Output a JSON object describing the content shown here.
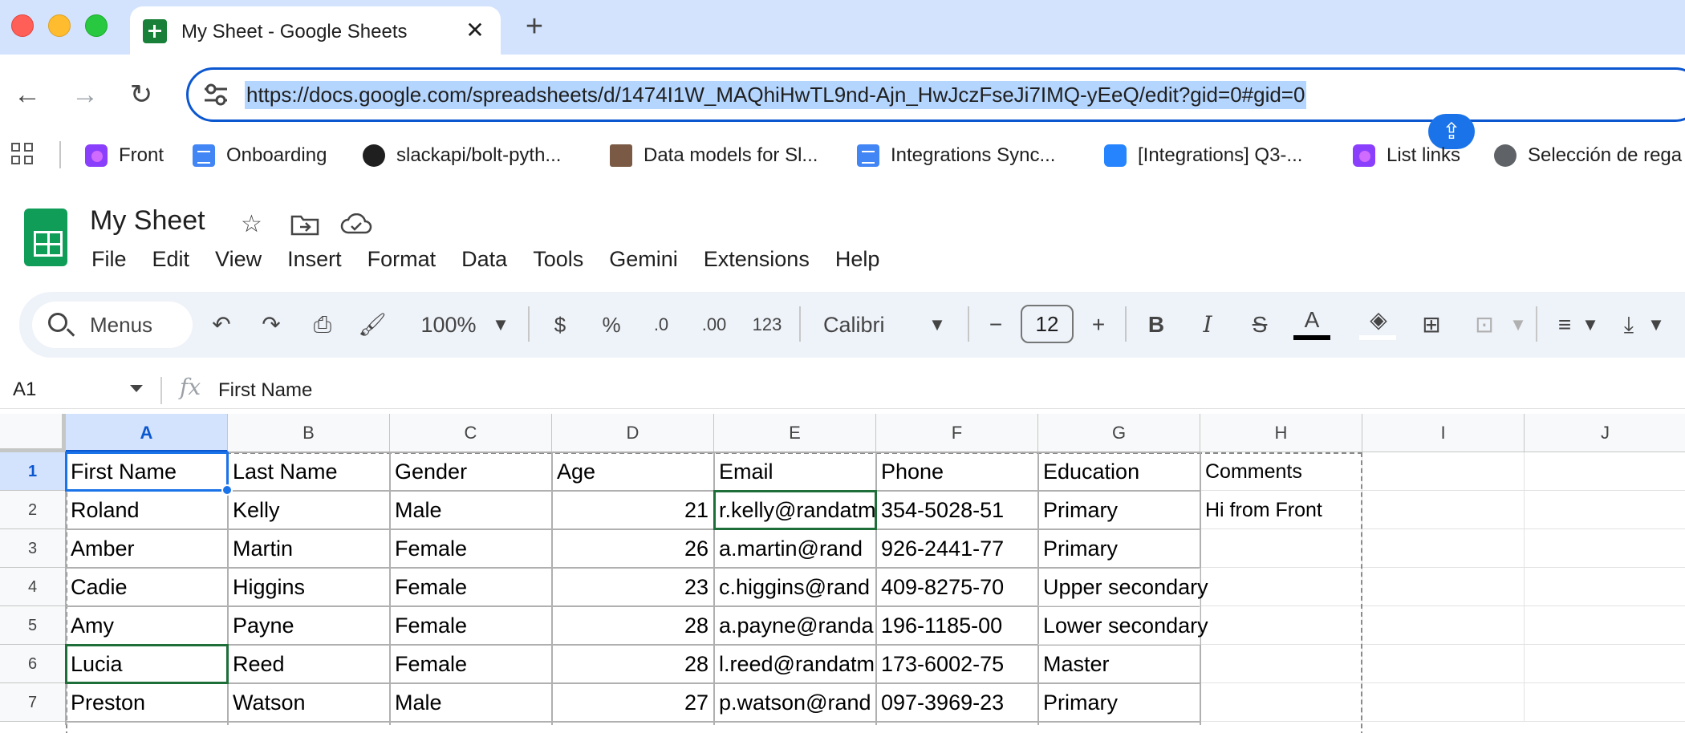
{
  "browser": {
    "tab_title": "My Sheet - Google Sheets",
    "tab_close": "✕",
    "new_tab": "+",
    "url": "https://docs.google.com/spreadsheets/d/1474I1W_MAQhiHwTL9nd-Ajn_HwJczFseJi7IMQ-yEeQ/edit?gid=0#gid=0",
    "bookmarks": [
      {
        "label": "Front",
        "icon": "front"
      },
      {
        "label": "Onboarding",
        "icon": "doc"
      },
      {
        "label": "slackapi/bolt-pyth...",
        "icon": "gh"
      },
      {
        "label": "Data models for Sl...",
        "icon": "photo"
      },
      {
        "label": "Integrations Sync...",
        "icon": "doc"
      },
      {
        "label": "[Integrations] Q3-...",
        "icon": "jira"
      },
      {
        "label": "List links",
        "icon": "front"
      },
      {
        "label": "Selección de rega",
        "icon": "globe"
      }
    ]
  },
  "sheet": {
    "title": "My Sheet",
    "menus": [
      "File",
      "Edit",
      "View",
      "Insert",
      "Format",
      "Data",
      "Tools",
      "Gemini",
      "Extensions",
      "Help"
    ],
    "toolbar": {
      "search_label": "Menus",
      "zoom": "100%",
      "currency": "$",
      "percent": "%",
      "dec_decrease": ".0",
      "dec_increase": ".00",
      "number_format": "123",
      "font": "Calibri",
      "font_size": "12",
      "bold": "B",
      "italic": "I",
      "strike": "S",
      "text_color": "A"
    },
    "name_box": "A1",
    "formula": "First Name",
    "columns": [
      "A",
      "B",
      "C",
      "D",
      "E",
      "F",
      "G",
      "H",
      "I",
      "J"
    ],
    "rows": [
      "1",
      "2",
      "3",
      "4",
      "5",
      "6",
      "7"
    ],
    "cells": [
      [
        "First Name",
        "Last Name",
        "Gender",
        "Age",
        "Email",
        "Phone",
        "Education",
        "Comments"
      ],
      [
        "Roland",
        "Kelly",
        "Male",
        "21",
        "r.kelly@randatm",
        "354-5028-51",
        "Primary",
        "Hi from Front"
      ],
      [
        "Amber",
        "Martin",
        "Female",
        "26",
        "a.martin@rand",
        "926-2441-77",
        "Primary",
        ""
      ],
      [
        "Cadie",
        "Higgins",
        "Female",
        "23",
        "c.higgins@rand",
        "409-8275-70",
        "Upper secondary",
        ""
      ],
      [
        "Amy",
        "Payne",
        "Female",
        "28",
        "a.payne@randa",
        "196-1185-00",
        "Lower secondary",
        ""
      ],
      [
        "Lucia",
        "Reed",
        "Female",
        "28",
        "l.reed@randatm",
        "173-6002-75",
        "Master",
        ""
      ],
      [
        "Preston",
        "Watson",
        "Male",
        "27",
        "p.watson@rand",
        "097-3969-23",
        "Primary",
        ""
      ]
    ],
    "colors": {
      "accent": "#0b57d0",
      "sheets_green": "#0f9d58",
      "selection_header": "#d3e3fd",
      "highlight_green": "#1e6e3a"
    }
  }
}
